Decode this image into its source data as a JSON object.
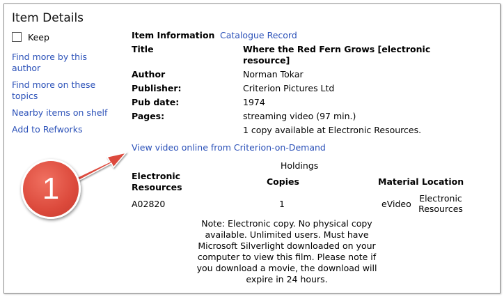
{
  "panel": {
    "title": "Item Details"
  },
  "sidebar": {
    "keep_label": "Keep",
    "links": [
      "Find more by this author",
      "Find more on these topics",
      "Nearby items on shelf",
      "Add to Refworks"
    ]
  },
  "info": {
    "header_label": "Item Information",
    "catalogue_link": "Catalogue Record",
    "title_label": "Title",
    "title_value": "Where the Red Fern Grows [electronic resource]",
    "author_label": "Author",
    "author_value": "Norman Tokar",
    "publisher_label": "Publisher:",
    "publisher_value": "Criterion Pictures Ltd",
    "pubdate_label": "Pub date:",
    "pubdate_value": "1974",
    "pages_label": "Pages:",
    "pages_value": "streaming video (97 min.)",
    "availability": "1 copy available at Electronic Resources."
  },
  "video_link": "View video online from Criterion-on-Demand",
  "holdings": {
    "heading": "Holdings",
    "columns": [
      "Electronic Resources",
      "Copies",
      "Material",
      "Location"
    ],
    "row": [
      "A02820",
      "1",
      "eVideo",
      "Electronic Resources"
    ],
    "note": "Note: Electronic copy. No physical copy available. Unlimited users. Must have Microsoft Silverlight downloaded on your computer to view this film. Please note if you download a movie, the download will expire in 24 hours."
  },
  "callout": {
    "number": "1",
    "color": "#dc4a3c"
  }
}
